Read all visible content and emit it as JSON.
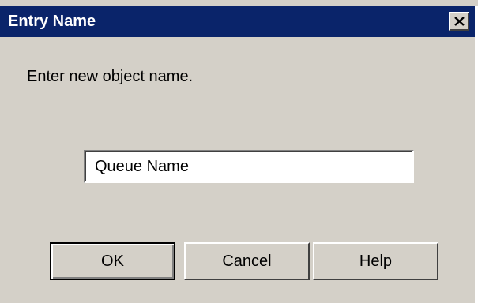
{
  "dialog": {
    "title": "Entry Name",
    "close_icon": "close-x-icon",
    "prompt": "Enter new object name.",
    "name_input": {
      "value": "Queue Name",
      "placeholder": ""
    },
    "buttons": {
      "ok_label": "OK",
      "cancel_label": "Cancel",
      "help_label": "Help"
    }
  },
  "colors": {
    "titlebar": "#0a246a",
    "title_text": "#ffffff",
    "dialog_bg": "#d4d0c8"
  }
}
